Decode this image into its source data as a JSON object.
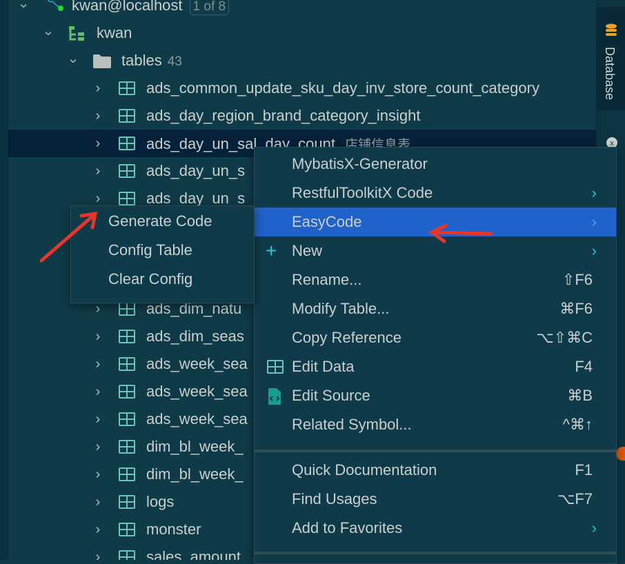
{
  "tree": {
    "connection": {
      "label": "kwan@localhost",
      "badge": "1 of 8"
    },
    "schema": {
      "label": "kwan"
    },
    "folder": {
      "label": "tables",
      "count": "43"
    },
    "tables": [
      {
        "name": "ads_common_update_sku_day_inv_store_count_category",
        "comment": ""
      },
      {
        "name": "ads_day_region_brand_category_insight",
        "comment": ""
      },
      {
        "name": "ads_day_un_sal_day_count",
        "comment": "店铺信息表",
        "selected": true
      },
      {
        "name": "ads_day_un_s",
        "comment": ""
      },
      {
        "name": "ads_day_un_s",
        "comment": ""
      },
      {
        "name": "",
        "comment": ""
      },
      {
        "name": "",
        "comment": ""
      },
      {
        "name": "",
        "comment": ""
      },
      {
        "name": "ads_dim_natu",
        "comment": ""
      },
      {
        "name": "ads_dim_seas",
        "comment": ""
      },
      {
        "name": "ads_week_sea",
        "comment": ""
      },
      {
        "name": "ads_week_sea",
        "comment": ""
      },
      {
        "name": "ads_week_sea",
        "comment": ""
      },
      {
        "name": "dim_bl_week_",
        "comment": ""
      },
      {
        "name": "dim_bl_week_",
        "comment": ""
      },
      {
        "name": "logs",
        "comment": ""
      },
      {
        "name": "monster",
        "comment": ""
      },
      {
        "name": "sales_amount",
        "comment": ""
      }
    ]
  },
  "sidebar": {
    "database_tab": "Database"
  },
  "context_menu": {
    "items": [
      {
        "label": "MybatisX-Generator",
        "shortcut": "",
        "submenu": false,
        "icon": ""
      },
      {
        "label": "RestfulToolkitX Code",
        "shortcut": "",
        "submenu": true,
        "icon": ""
      },
      {
        "label": "EasyCode",
        "shortcut": "",
        "submenu": true,
        "icon": "",
        "highlighted": true
      },
      {
        "label": "New",
        "shortcut": "",
        "submenu": true,
        "icon": "plus-icon"
      },
      {
        "label": "Rename...",
        "shortcut": "⇧F6",
        "submenu": false,
        "icon": ""
      },
      {
        "label": "Modify Table...",
        "shortcut": "⌘F6",
        "submenu": false,
        "icon": ""
      },
      {
        "label": "Copy Reference",
        "shortcut": "⌥⇧⌘C",
        "submenu": false,
        "icon": ""
      },
      {
        "label": "Edit Data",
        "shortcut": "F4",
        "submenu": false,
        "icon": "table-icon"
      },
      {
        "label": "Edit Source",
        "shortcut": "⌘B",
        "submenu": false,
        "icon": "source-file-icon"
      },
      {
        "label": "Related Symbol...",
        "shortcut": "^⌘↑",
        "submenu": false,
        "icon": ""
      },
      {
        "label": "Quick Documentation",
        "shortcut": "F1",
        "submenu": false,
        "icon": ""
      },
      {
        "label": "Find Usages",
        "shortcut": "⌥F7",
        "submenu": false,
        "icon": ""
      },
      {
        "label": "Add to Favorites",
        "shortcut": "",
        "submenu": true,
        "icon": ""
      }
    ]
  },
  "easycode_submenu": {
    "items": [
      {
        "label": "Generate Code"
      },
      {
        "label": "Config Table"
      },
      {
        "label": "Clear Config"
      }
    ]
  },
  "colors": {
    "highlight": "#1f62c9",
    "annotation_arrow": "#e8352a",
    "accent": "#2bc3d8"
  }
}
